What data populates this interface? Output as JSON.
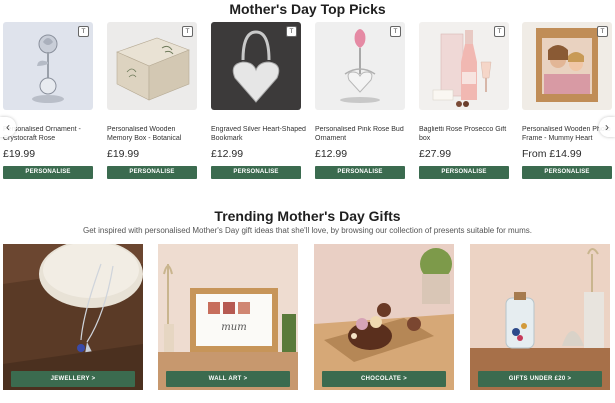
{
  "top_picks": {
    "title": "Mother's Day Top Picks",
    "badge_icon": "personalise-tag-icon",
    "badge_glyph": "T",
    "button_label": "PERSONALISE",
    "products": [
      {
        "name": "Personalised Ornament - Crystocraft Rose",
        "price": "£19.99"
      },
      {
        "name": "Personalised Wooden Memory Box - Botanical",
        "price": "£19.99"
      },
      {
        "name": "Engraved Silver Heart-Shaped Bookmark",
        "price": "£12.99"
      },
      {
        "name": "Personalised Pink Rose Bud Ornament",
        "price": "£12.99"
      },
      {
        "name": "Baglietti Rose Prosecco Gift box",
        "price": "£27.99"
      },
      {
        "name": "Personalised Wooden Photo Frame - Mummy Heart",
        "price": "From £14.99"
      }
    ],
    "prev_glyph": "‹",
    "next_glyph": "›"
  },
  "trending": {
    "title": "Trending Mother's Day Gifts",
    "subtitle": "Get inspired with personalised Mother's Day gift ideas that she'll love, by browsing our collection of presents suitable for mums.",
    "categories": [
      {
        "label": "JEWELLERY >"
      },
      {
        "label": "WALL ART >"
      },
      {
        "label": "CHOCOLATE >"
      },
      {
        "label": "GIFTS UNDER £20 >"
      }
    ],
    "frame_text": "mum"
  },
  "colors": {
    "accent": "#3b6b4f"
  }
}
